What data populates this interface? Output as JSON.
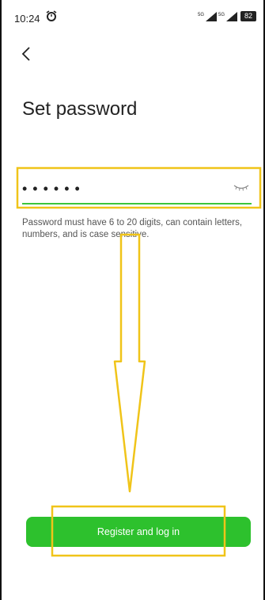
{
  "status_bar": {
    "time": "10:24",
    "signal_label_1": "5G",
    "signal_label_2": "5G",
    "battery": "82"
  },
  "page": {
    "title": "Set password"
  },
  "password_field": {
    "value": "••••••",
    "icon": "eye-hidden-icon"
  },
  "helper": {
    "text": "Password must have 6 to 20 digits, can contain letters, numbers, and is case sensitive."
  },
  "actions": {
    "register_label": "Register and log in"
  },
  "colors": {
    "accent": "#2dc12d",
    "annotation": "#f0c419"
  }
}
